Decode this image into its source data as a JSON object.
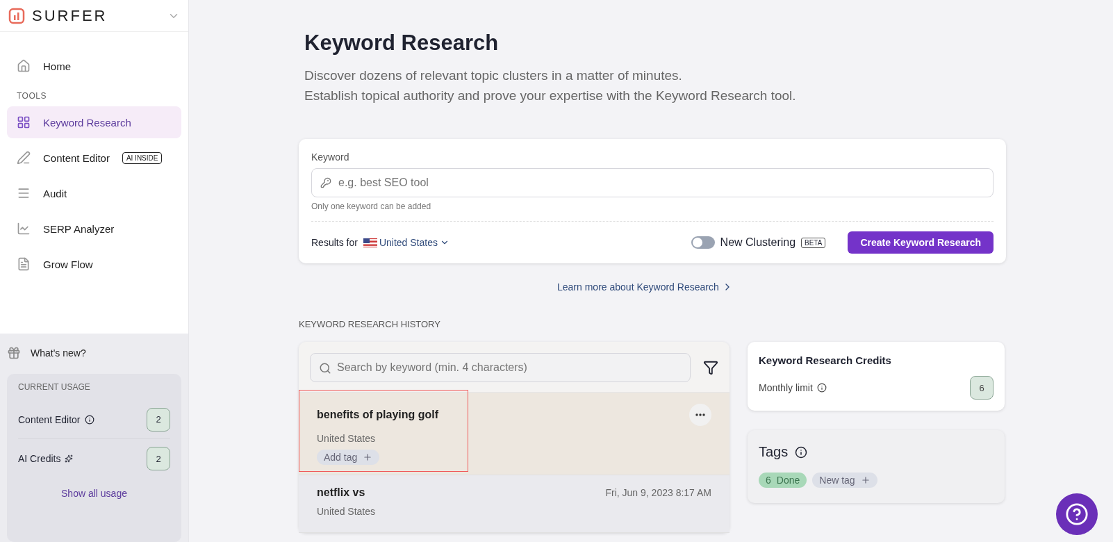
{
  "sidebar": {
    "brand": "SURFER",
    "nav": [
      {
        "label": "Home",
        "selected": false
      }
    ],
    "section_label": "TOOLS",
    "tools": [
      {
        "label": "Keyword Research",
        "selected": true
      },
      {
        "label": "Content Editor",
        "selected": false,
        "badge": "AI INSIDE"
      },
      {
        "label": "Audit",
        "selected": false
      },
      {
        "label": "SERP Analyzer",
        "selected": false
      },
      {
        "label": "Grow Flow",
        "selected": false
      }
    ],
    "whats_new": "What's new?",
    "usage": {
      "title": "CURRENT USAGE",
      "rows": [
        {
          "label": "Content Editor",
          "value": "2"
        },
        {
          "label": "AI Credits",
          "value": "2"
        }
      ],
      "link": "Show all usage"
    }
  },
  "header": {
    "title": "Keyword Research",
    "subtitle": [
      "Discover dozens of relevant topic clusters in a matter of minutes.",
      "Establish topical authority and prove your expertise with the Keyword Research tool."
    ]
  },
  "form": {
    "label": "Keyword",
    "placeholder": "e.g. best SEO tool",
    "hint": "Only one keyword can be added",
    "results_for": "Results for",
    "country": "United States",
    "toggle": {
      "label": "New Clustering",
      "badge": "BETA",
      "on": false
    },
    "button": "Create Keyword Research"
  },
  "learn_more": "Learn more about Keyword Research",
  "history": {
    "title": "KEYWORD RESEARCH HISTORY",
    "search_placeholder": "Search by keyword (min. 4 characters)",
    "items": [
      {
        "keyword": "benefits of playing golf",
        "country": "United States",
        "tag": "Add tag",
        "highlighted": true
      },
      {
        "keyword": "netflix vs",
        "country": "United States",
        "date": "Fri, Jun 9, 2023 8:17 AM",
        "highlighted": false
      }
    ]
  },
  "credits": {
    "title": "Keyword Research Credits",
    "label": "Monthly limit",
    "value": "6"
  },
  "tags": {
    "title": "Tags",
    "items": [
      {
        "count": "6",
        "label": "Done",
        "kind": "tag"
      },
      {
        "label": "New tag",
        "kind": "new"
      }
    ]
  }
}
